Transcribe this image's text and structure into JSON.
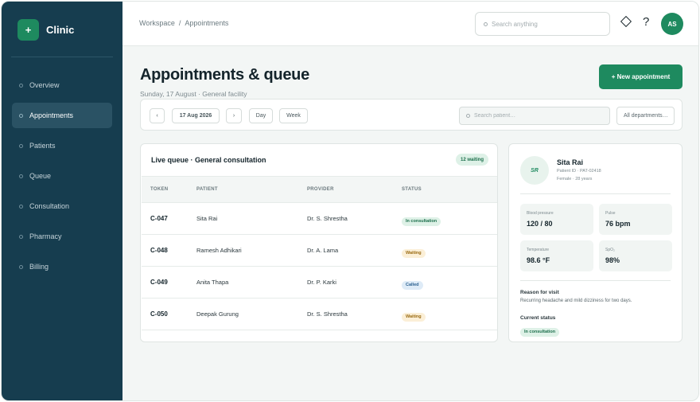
{
  "brand": {
    "logo": "+",
    "name": "Clinic"
  },
  "nav": [
    {
      "label": "Overview"
    },
    {
      "label": "Appointments",
      "active": true
    },
    {
      "label": "Patients"
    },
    {
      "label": "Queue"
    },
    {
      "label": "Consultation"
    },
    {
      "label": "Pharmacy"
    },
    {
      "label": "Billing"
    }
  ],
  "topbar": {
    "breadcrumb": [
      "Workspace",
      "Appointments"
    ],
    "breadcrumb_sep": "/",
    "search_placeholder": "Search anything",
    "help_label": "?",
    "avatar_initials": "AS"
  },
  "page": {
    "title": "Appointments & queue",
    "subtitle": "Sunday, 17 August · General facility",
    "new_button": "+ New appointment"
  },
  "filters": {
    "prev": "‹",
    "date": "17 Aug 2026",
    "next": "›",
    "day": "Day",
    "week": "Week",
    "patient_search_placeholder": "Search patient…",
    "department": "All departments…"
  },
  "queue": {
    "title": "Live queue · General consultation",
    "badge": "12 waiting",
    "columns": [
      "TOKEN",
      "PATIENT",
      "PROVIDER",
      "STATUS"
    ],
    "rows": [
      {
        "token": "C-047",
        "patient": "Sita Rai",
        "provider": "Dr. S. Shrestha",
        "status": "In consultation",
        "status_kind": "consult"
      },
      {
        "token": "C-048",
        "patient": "Ramesh Adhikari",
        "provider": "Dr. A. Lama",
        "status": "Waiting",
        "status_kind": "waiting"
      },
      {
        "token": "C-049",
        "patient": "Anita Thapa",
        "provider": "Dr. P. Karki",
        "status": "Called",
        "status_kind": "called"
      },
      {
        "token": "C-050",
        "patient": "Deepak Gurung",
        "provider": "Dr. S. Shrestha",
        "status": "Waiting",
        "status_kind": "waiting"
      }
    ]
  },
  "patient": {
    "initials": "SR",
    "name": "Sita Rai",
    "id": "Patient ID · PAT-02418",
    "meta": "Female · 28 years",
    "vitals": [
      {
        "label": "Blood pressure",
        "value": "120 / 80"
      },
      {
        "label": "Pulse",
        "value": "76 bpm"
      },
      {
        "label": "Temperature",
        "value": "98.6 °F"
      },
      {
        "label": "SpO₂",
        "value": "98%"
      }
    ],
    "reason_label": "Reason for visit",
    "reason_text": "Recurring headache and mild dizziness for two days.",
    "current_status_label": "Current status",
    "current_status": "In consultation"
  },
  "colors": {
    "sidebar": "#163d4f",
    "accent": "#1e8a5f",
    "background": "#f3f6f5"
  }
}
